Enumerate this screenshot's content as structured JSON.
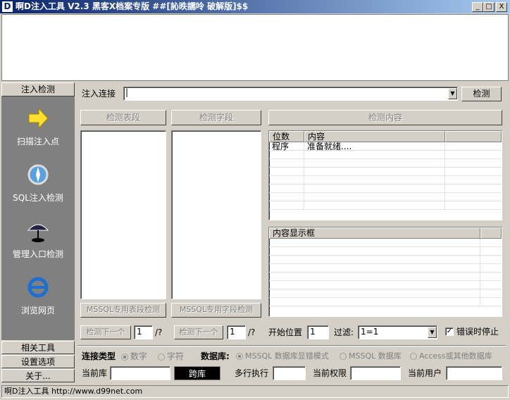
{
  "window": {
    "icon_letter": "D",
    "title": "啊D注入工具 V2.3 黑客X档案专版 ##[訫昳譳呤 破解版]$$",
    "minimize": "_",
    "maximize": "□",
    "close": "X"
  },
  "sidebar": {
    "header": "注入检测",
    "items": [
      {
        "label": "扫描注入点",
        "icon": "arrow-right-icon"
      },
      {
        "label": "SQL注入检测",
        "icon": "compass-icon"
      },
      {
        "label": "管理入口检测",
        "icon": "umbrella-icon"
      },
      {
        "label": "浏览网页",
        "icon": "ie-icon"
      }
    ],
    "bottom": [
      "相关工具",
      "设置选项",
      "关于..."
    ]
  },
  "inject": {
    "label": "注入连接",
    "url_value": "",
    "detect_button": "检测"
  },
  "buttons": {
    "tables": "检测表段",
    "fields": "检测字段",
    "content": "检测内容",
    "mssql_tables": "MSSQL专用表段检测",
    "mssql_fields": "MSSQL专用字段检测",
    "next1": "检测下一个",
    "next2": "检测下一个"
  },
  "result_table": {
    "headers": [
      "位数",
      "内容"
    ],
    "rows": [
      [
        "程序",
        "准备就绪...."
      ]
    ]
  },
  "content_box": {
    "header": "内容显示框"
  },
  "paging": {
    "page1": "1",
    "total1": "/?",
    "page2": "1",
    "total2": "/?",
    "start_label": "开始位置",
    "start_value": "1",
    "filter_label": "过滤:",
    "filter_value": "1=1",
    "stop_on_error": "错误时停止",
    "stop_checked": true
  },
  "conn": {
    "type_label": "连接类型",
    "type_options": [
      "数字",
      "字符"
    ],
    "type_selected": 0,
    "db_label": "数据库:",
    "db_options": [
      "MSSQL 数据库显错模式",
      "MSSQL 数据库",
      "Access或其他数据库"
    ],
    "db_selected": 0
  },
  "info": {
    "current_db": "当前库",
    "cross_db": "跨库",
    "multi_exec": "多行执行",
    "privilege": "当前权限",
    "user": "当前用户"
  },
  "status": {
    "text": "啊D注入工具  http://www.d99net.com"
  }
}
